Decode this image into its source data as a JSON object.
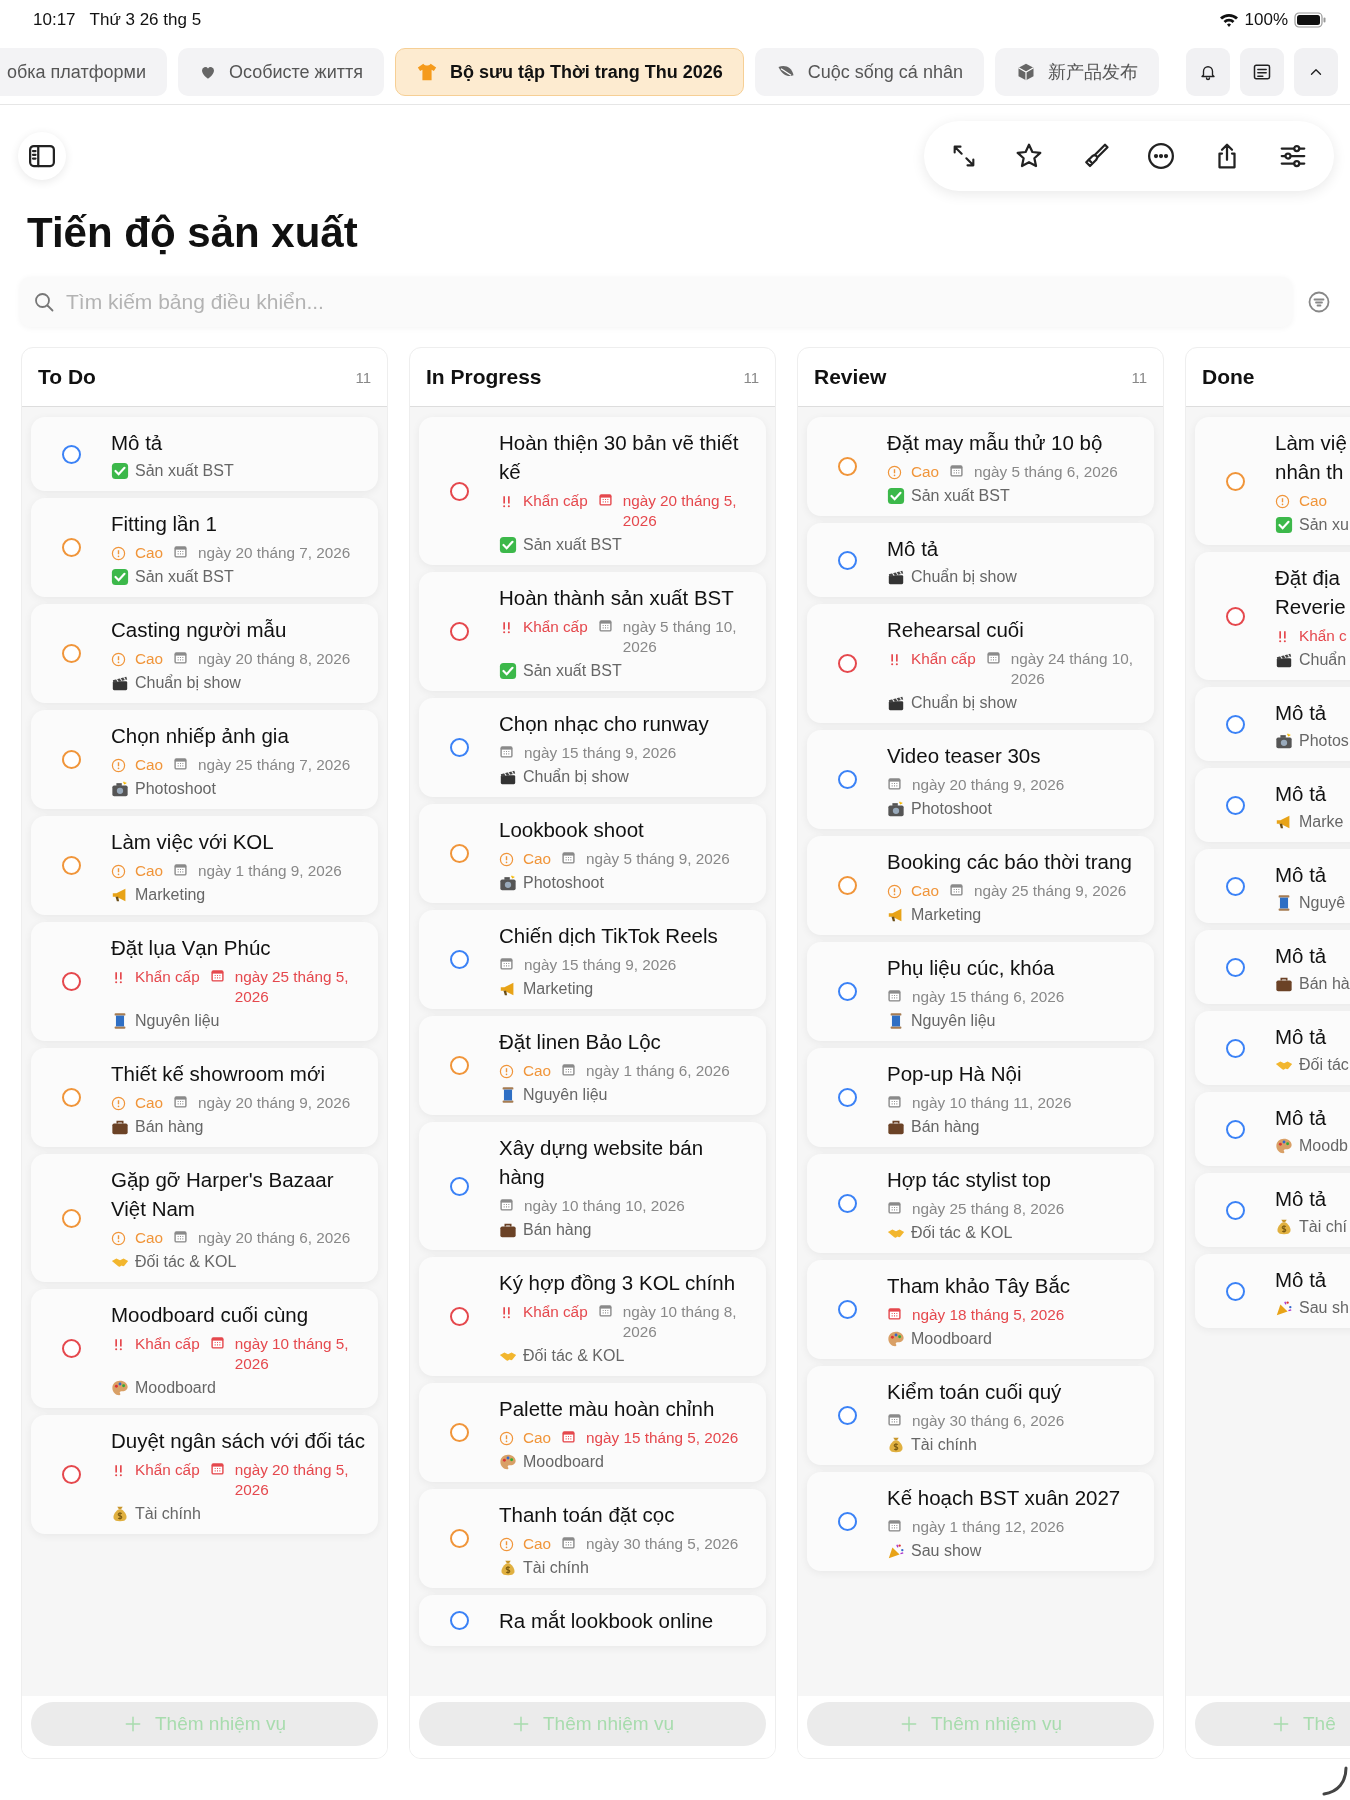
{
  "status_bar": {
    "time": "10:17",
    "date": "Thứ 3 26 thg 5",
    "battery": "100%"
  },
  "tabs": [
    {
      "kind": "work",
      "label": "обка платформи",
      "selected": false
    },
    {
      "kind": "personal",
      "label": "Особисте життя",
      "selected": false
    },
    {
      "kind": "fashion",
      "label": "Bộ sưu tập Thời trang Thu 2026",
      "selected": true
    },
    {
      "kind": "life",
      "label": "Cuộc sống cá nhân",
      "selected": false
    },
    {
      "kind": "product",
      "label": "新产品发布",
      "selected": false
    }
  ],
  "page_title": "Tiến độ sản xuất",
  "search": {
    "placeholder": "Tìm kiếm bảng điều khiển..."
  },
  "columns": [
    {
      "title": "To Do",
      "count": "11",
      "add_label": "Thêm nhiệm vụ",
      "add_disabled": true,
      "cards": [
        {
          "title": "Mô tả",
          "tag": {
            "kind": "production",
            "label": "Sản xuất BST"
          }
        },
        {
          "title": "Fitting lần 1",
          "priority": {
            "kind": "high",
            "label": "Cao"
          },
          "date": {
            "text": "ngày 20 tháng 7, 2026",
            "overdue": false
          },
          "tag": {
            "kind": "production",
            "label": "Sản xuất BST"
          }
        },
        {
          "title": "Casting người mẫu",
          "priority": {
            "kind": "high",
            "label": "Cao"
          },
          "date": {
            "text": "ngày 20 tháng 8, 2026",
            "overdue": false
          },
          "tag": {
            "kind": "show",
            "label": "Chuẩn bị show"
          }
        },
        {
          "title": "Chọn nhiếp ảnh gia",
          "priority": {
            "kind": "high",
            "label": "Cao"
          },
          "date": {
            "text": "ngày 25 tháng 7, 2026",
            "overdue": false
          },
          "tag": {
            "kind": "photo",
            "label": "Photoshoot"
          }
        },
        {
          "title": "Làm việc với KOL",
          "priority": {
            "kind": "high",
            "label": "Cao"
          },
          "date": {
            "text": "ngày 1 tháng 9, 2026",
            "overdue": false
          },
          "tag": {
            "kind": "marketing",
            "label": "Marketing"
          }
        },
        {
          "title": "Đặt lụa Vạn Phúc",
          "priority": {
            "kind": "urgent",
            "label": "Khẩn cấp"
          },
          "date": {
            "text": "ngày 25 tháng 5, 2026",
            "overdue": true
          },
          "tag": {
            "kind": "material",
            "label": "Nguyên liệu"
          }
        },
        {
          "title": "Thiết kế showroom mới",
          "priority": {
            "kind": "high",
            "label": "Cao"
          },
          "date": {
            "text": "ngày 20 tháng 9, 2026",
            "overdue": false
          },
          "tag": {
            "kind": "sales",
            "label": "Bán hàng"
          }
        },
        {
          "title": "Gặp gỡ Harper's Bazaar Việt Nam",
          "priority": {
            "kind": "high",
            "label": "Cao"
          },
          "date": {
            "text": "ngày 20 tháng 6, 2026",
            "overdue": false
          },
          "tag": {
            "kind": "partner",
            "label": "Đối tác & KOL"
          }
        },
        {
          "title": "Moodboard cuối cùng",
          "priority": {
            "kind": "urgent",
            "label": "Khẩn cấp"
          },
          "date": {
            "text": "ngày 10 tháng 5, 2026",
            "overdue": true
          },
          "tag": {
            "kind": "moodboard",
            "label": "Moodboard"
          }
        },
        {
          "title": "Duyệt ngân sách với đối tác",
          "priority": {
            "kind": "urgent",
            "label": "Khẩn cấp"
          },
          "date": {
            "text": "ngày 20 tháng 5, 2026",
            "overdue": true
          },
          "tag": {
            "kind": "finance",
            "label": "Tài chính"
          }
        }
      ]
    },
    {
      "title": "In Progress",
      "count": "11",
      "add_label": "Thêm nhiệm vụ",
      "add_disabled": true,
      "cards": [
        {
          "title": "Hoàn thiện 30 bản vẽ thiết kế",
          "priority": {
            "kind": "urgent",
            "label": "Khẩn cấp"
          },
          "date": {
            "text": "ngày 20 tháng 5, 2026",
            "overdue": true
          },
          "tag": {
            "kind": "production",
            "label": "Sản xuất BST"
          }
        },
        {
          "title": "Hoàn thành sản xuất BST",
          "priority": {
            "kind": "urgent",
            "label": "Khẩn cấp"
          },
          "date": {
            "text": "ngày 5 tháng 10, 2026",
            "overdue": false
          },
          "tag": {
            "kind": "production",
            "label": "Sản xuất BST"
          }
        },
        {
          "title": "Chọn nhạc cho runway",
          "date": {
            "text": "ngày 15 tháng 9, 2026",
            "overdue": false
          },
          "tag": {
            "kind": "show",
            "label": "Chuẩn bị show"
          }
        },
        {
          "title": "Lookbook shoot",
          "priority": {
            "kind": "high",
            "label": "Cao"
          },
          "date": {
            "text": "ngày 5 tháng 9, 2026",
            "overdue": false
          },
          "tag": {
            "kind": "photo",
            "label": "Photoshoot"
          }
        },
        {
          "title": "Chiến dịch TikTok Reels",
          "date": {
            "text": "ngày 15 tháng 9, 2026",
            "overdue": false
          },
          "tag": {
            "kind": "marketing",
            "label": "Marketing"
          }
        },
        {
          "title": "Đặt linen Bảo Lộc",
          "priority": {
            "kind": "high",
            "label": "Cao"
          },
          "date": {
            "text": "ngày 1 tháng 6, 2026",
            "overdue": false
          },
          "tag": {
            "kind": "material",
            "label": "Nguyên liệu"
          }
        },
        {
          "title": "Xây dựng website bán hàng",
          "date": {
            "text": "ngày 10 tháng 10, 2026",
            "overdue": false
          },
          "tag": {
            "kind": "sales",
            "label": "Bán hàng"
          }
        },
        {
          "title": "Ký hợp đồng 3 KOL chính",
          "priority": {
            "kind": "urgent",
            "label": "Khẩn cấp"
          },
          "date": {
            "text": "ngày 10 tháng 8, 2026",
            "overdue": false
          },
          "tag": {
            "kind": "partner",
            "label": "Đối tác & KOL"
          }
        },
        {
          "title": "Palette màu hoàn chỉnh",
          "priority": {
            "kind": "high",
            "label": "Cao"
          },
          "date": {
            "text": "ngày 15 tháng 5, 2026",
            "overdue": true
          },
          "tag": {
            "kind": "moodboard",
            "label": "Moodboard"
          }
        },
        {
          "title": "Thanh toán đặt cọc",
          "priority": {
            "kind": "high",
            "label": "Cao"
          },
          "date": {
            "text": "ngày 30 tháng 5, 2026",
            "overdue": false
          },
          "tag": {
            "kind": "finance",
            "label": "Tài chính"
          }
        },
        {
          "title": "Ra mắt lookbook online"
        }
      ]
    },
    {
      "title": "Review",
      "count": "11",
      "add_label": "Thêm nhiệm vụ",
      "add_disabled": true,
      "cards": [
        {
          "title": "Đặt may mẫu thử 10 bộ",
          "priority": {
            "kind": "high",
            "label": "Cao"
          },
          "date": {
            "text": "ngày 5 tháng 6, 2026",
            "overdue": false
          },
          "tag": {
            "kind": "production",
            "label": "Sản xuất BST"
          }
        },
        {
          "title": "Mô tả",
          "tag": {
            "kind": "show",
            "label": "Chuẩn bị show"
          }
        },
        {
          "title": "Rehearsal cuối",
          "priority": {
            "kind": "urgent",
            "label": "Khẩn cấp"
          },
          "date": {
            "text": "ngày 24 tháng 10, 2026",
            "overdue": false
          },
          "tag": {
            "kind": "show",
            "label": "Chuẩn bị show"
          }
        },
        {
          "title": "Video teaser 30s",
          "date": {
            "text": "ngày 20 tháng 9, 2026",
            "overdue": false
          },
          "tag": {
            "kind": "photo",
            "label": "Photoshoot"
          }
        },
        {
          "title": "Booking các báo thời trang",
          "priority": {
            "kind": "high",
            "label": "Cao"
          },
          "date": {
            "text": "ngày 25 tháng 9, 2026",
            "overdue": false
          },
          "tag": {
            "kind": "marketing",
            "label": "Marketing"
          }
        },
        {
          "title": "Phụ liệu cúc, khóa",
          "date": {
            "text": "ngày 15 tháng 6, 2026",
            "overdue": false
          },
          "tag": {
            "kind": "material",
            "label": "Nguyên liệu"
          }
        },
        {
          "title": "Pop-up Hà Nội",
          "date": {
            "text": "ngày 10 tháng 11, 2026",
            "overdue": false
          },
          "tag": {
            "kind": "sales",
            "label": "Bán hàng"
          }
        },
        {
          "title": "Hợp tác stylist top",
          "date": {
            "text": "ngày 25 tháng 8, 2026",
            "overdue": false
          },
          "tag": {
            "kind": "partner",
            "label": "Đối tác & KOL"
          }
        },
        {
          "title": "Tham khảo Tây Bắc",
          "date": {
            "text": "ngày 18 tháng 5, 2026",
            "overdue": true
          },
          "tag": {
            "kind": "moodboard",
            "label": "Moodboard"
          }
        },
        {
          "title": "Kiểm toán cuối quý",
          "date": {
            "text": "ngày 30 tháng 6, 2026",
            "overdue": false
          },
          "tag": {
            "kind": "finance",
            "label": "Tài chính"
          }
        },
        {
          "title": "Kế hoạch BST xuân 2027",
          "date": {
            "text": "ngày 1 tháng 12, 2026",
            "overdue": false
          },
          "tag": {
            "kind": "after",
            "label": "Sau show"
          }
        }
      ]
    },
    {
      "title": "Done",
      "add_label": "Thê",
      "add_disabled": true,
      "cards": [
        {
          "title": "Làm việ\nnhân th",
          "priority": {
            "kind": "high",
            "label": "Cao"
          },
          "tag": {
            "kind": "production",
            "label": "Sản xu"
          }
        },
        {
          "title": "Đặt địa\nReverie",
          "priority": {
            "kind": "urgent",
            "label": "Khẩn c"
          },
          "tag": {
            "kind": "show",
            "label": "Chuẩn"
          }
        },
        {
          "title": "Mô tả",
          "tag": {
            "kind": "photo",
            "label": "Photos"
          }
        },
        {
          "title": "Mô tả",
          "tag": {
            "kind": "marketing",
            "label": "Marke"
          }
        },
        {
          "title": "Mô tả",
          "tag": {
            "kind": "material",
            "label": "Nguyê"
          }
        },
        {
          "title": "Mô tả",
          "tag": {
            "kind": "sales",
            "label": "Bán hà"
          }
        },
        {
          "title": "Mô tả",
          "tag": {
            "kind": "partner",
            "label": "Đối tác"
          }
        },
        {
          "title": "Mô tả",
          "tag": {
            "kind": "moodboard",
            "label": "Moodb"
          }
        },
        {
          "title": "Mô tả",
          "tag": {
            "kind": "finance",
            "label": "Tài chí"
          }
        },
        {
          "title": "Mô tả",
          "tag": {
            "kind": "after",
            "label": "Sau sh"
          }
        }
      ]
    }
  ]
}
